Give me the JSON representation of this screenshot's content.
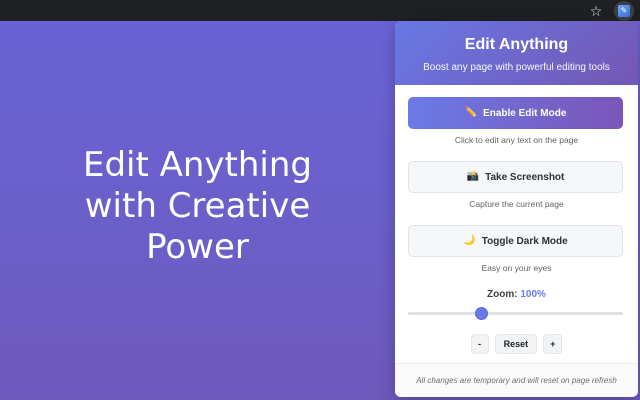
{
  "browser": {
    "star_icon": "star-icon",
    "extension_icon": "edit-anything-extension-icon"
  },
  "page": {
    "hero_text": "Edit Anything with Creative Power"
  },
  "popup": {
    "title": "Edit Anything",
    "subtitle": "Boost any page with powerful editing tools",
    "actions": [
      {
        "emoji": "✏️",
        "label": "Enable Edit Mode",
        "caption": "Click to edit any text on the page",
        "style": "primary"
      },
      {
        "emoji": "📸",
        "label": "Take Screenshot",
        "caption": "Capture the current page",
        "style": "secondary"
      },
      {
        "emoji": "🌙",
        "label": "Toggle Dark Mode",
        "caption": "Easy on your eyes",
        "style": "secondary"
      }
    ],
    "zoom": {
      "label": "Zoom:",
      "value": "100%",
      "slider_fraction": 0.34,
      "decrease_label": "-",
      "reset_label": "Reset",
      "increase_label": "+"
    },
    "footer": "All changes are temporary and will reset on page refresh"
  },
  "colors": {
    "page_background": "#6b5fc9",
    "accent": "#6878e4",
    "accent_end": "#7357b4"
  }
}
